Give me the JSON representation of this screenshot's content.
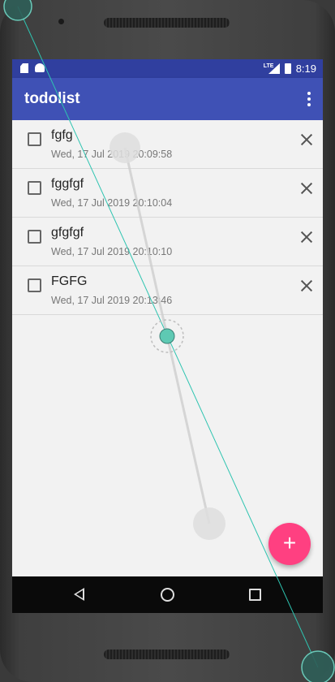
{
  "status_bar": {
    "network": "LTE",
    "time": "8:19"
  },
  "app_bar": {
    "title": "todolist",
    "overflow_icon": "more-vert-icon"
  },
  "todos": [
    {
      "title": "fgfg",
      "date": "Wed, 17 Jul 2019 20:09:58",
      "checked": false
    },
    {
      "title": "fggfgf",
      "date": "Wed, 17 Jul 2019 20:10:04",
      "checked": false
    },
    {
      "title": "gfgfgf",
      "date": "Wed, 17 Jul 2019 20:10:10",
      "checked": false
    },
    {
      "title": "FGFG",
      "date": "Wed, 17 Jul 2019 20:13:46",
      "checked": false
    }
  ],
  "fab": {
    "label": "+",
    "color": "#ff4081"
  },
  "nav_bar": {
    "icons": [
      "back-icon",
      "home-icon",
      "recents-icon"
    ]
  },
  "colors": {
    "primary": "#3f51b5",
    "primary_dark": "#303f9f",
    "accent": "#ff4081"
  }
}
